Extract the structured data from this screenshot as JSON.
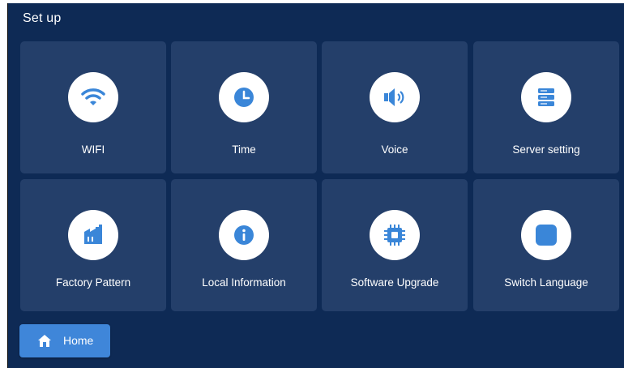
{
  "header": {
    "title": "Set up"
  },
  "tiles": [
    {
      "label": "WIFI",
      "icon": "wifi-icon"
    },
    {
      "label": "Time",
      "icon": "clock-icon"
    },
    {
      "label": "Voice",
      "icon": "speaker-icon"
    },
    {
      "label": "Server setting",
      "icon": "server-icon"
    },
    {
      "label": "Factory Pattern",
      "icon": "factory-icon"
    },
    {
      "label": "Local Information",
      "icon": "info-icon"
    },
    {
      "label": "Software Upgrade",
      "icon": "chip-icon"
    },
    {
      "label": "Switch Language",
      "icon": "square-icon"
    }
  ],
  "footer": {
    "home_label": "Home",
    "home_icon": "home-icon"
  },
  "colors": {
    "background": "#0e2a55",
    "tile": "#243f6a",
    "icon_accent": "#3a86d8",
    "button": "#3f86d9"
  }
}
